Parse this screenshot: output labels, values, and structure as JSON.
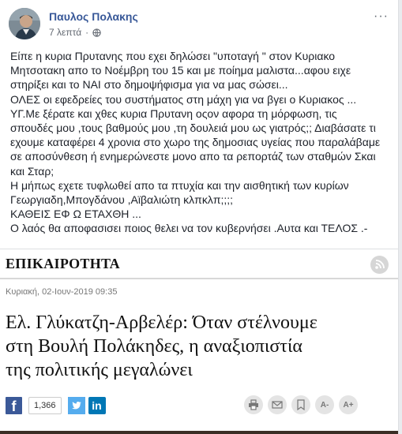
{
  "post": {
    "author": "Παυλος Πολακης",
    "time": "7 λεπτά",
    "separator": "·",
    "more_menu": "···",
    "lines": [
      "Είπε η κυρια Πρυτανης που εχει δηλώσει \"υποταγή \" στον Κυριακο",
      "Μητσοτακη απο το Νοέμβρη του 15 και με ποίημα μαλιστα...αφου ειχε",
      "στηρίξει και το ΝΑΙ στο δημοψήφισμα για να μας σώσει...",
      "ΟΛΕΣ οι εφεδρείες του συστήματος στη μάχη για να βγει ο Κυριακος ...",
      "ΥΓ.Με ξέρατε και χθες κυρια Πρυτανη οςον αφορα τη μόρφωση, τις",
      "σπουδές μου ,τους βαθμούς μου ,τη δουλειά μου ως γιατρός;; Διαβάσατε τι",
      "εχουμε καταφέρει 4 χρονια στο χωρο της δημοσιας υγείας που παραλάβαμε",
      "σε αποσύνθεση ή ενημερώνεστε μονο απο τα ρεπορτάζ των σταθμών Σκαι",
      "και Σταρ;",
      "Η μήπως εχετε τυφλωθεί απο τα πτυχία και την αισθητική των κυρίων",
      "Γεωργιαδη,Μπογδάνου ,Αϊβαλιώτη κλπκλπ;;;;",
      "ΚΑΘΕΙΣ ΕΦ Ω ΕΤΑΧΘΗ ...",
      "Ο λαός θα αποφασισει ποιος θελει να τον κυβερνήσει .Αυτα και ΤΕΛΟΣ .-"
    ]
  },
  "article": {
    "section": "ΕΠΙΚΑΙΡΟΤΗΤΑ",
    "date": "Κυριακή, 02-Ιουν-2019 09:35",
    "headline_lines": [
      "Ελ. Γλύκατζη-Αρβελέρ: Όταν στέλνουμε",
      "στη Βουλή Πολάκηδες, η αναξιοπιστία",
      "της πολιτικής μεγαλώνει"
    ],
    "share": {
      "facebook": "f",
      "count": "1,366",
      "linkedin": "in"
    },
    "tools": {
      "font_decrease": "A-",
      "font_increase": "A+"
    }
  },
  "colors": {
    "author_link": "#385898",
    "facebook": "#3b5998",
    "twitter": "#55acee",
    "linkedin": "#0077b5"
  },
  "icons": [
    "globe-icon",
    "rss-icon",
    "print-icon",
    "email-icon",
    "bookmark-icon"
  ]
}
